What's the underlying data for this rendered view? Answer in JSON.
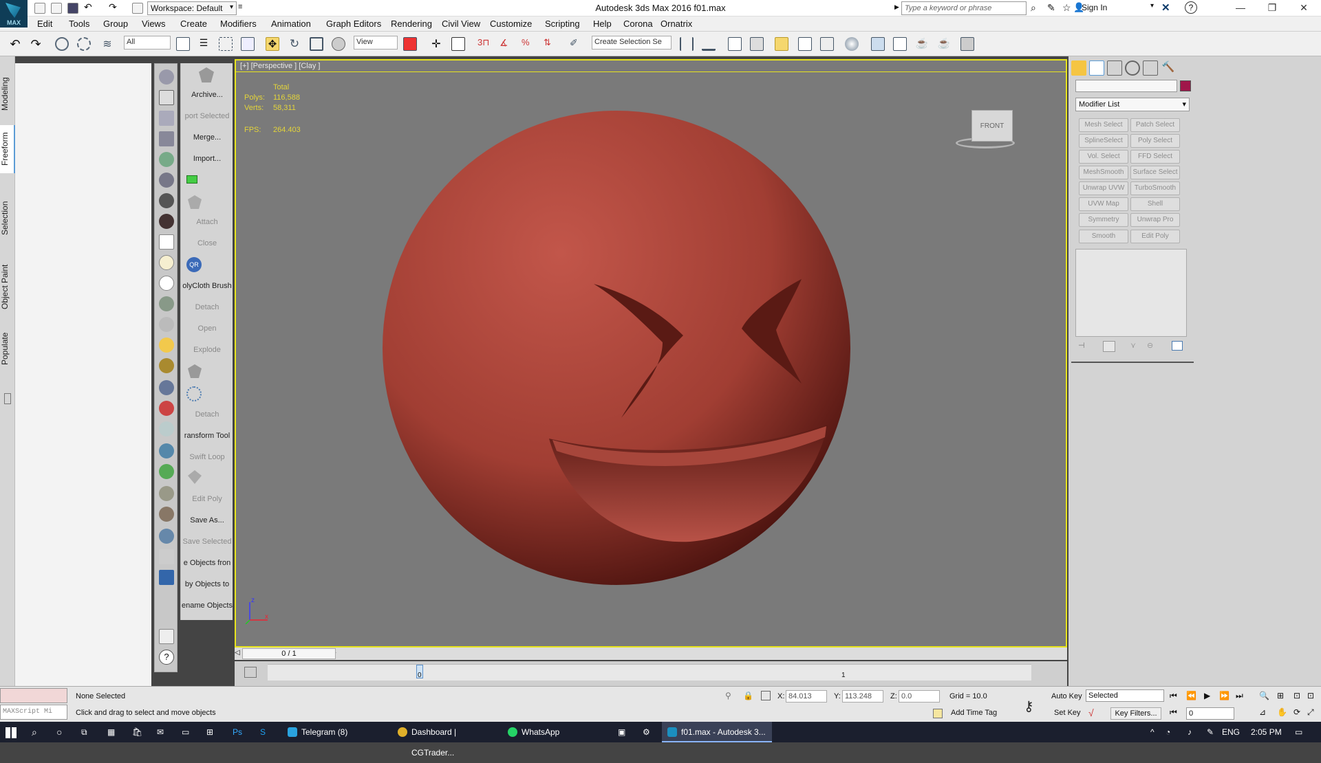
{
  "titlebar": {
    "workspace": "Workspace: Default",
    "title": "Autodesk 3ds Max 2016     f01.max",
    "search_placeholder": "Type a keyword or phrase",
    "sign_in": "Sign In",
    "logo": "MAX"
  },
  "menubar": [
    "Edit",
    "Tools",
    "Group",
    "Views",
    "Create",
    "Modifiers",
    "Animation",
    "Graph Editors",
    "Rendering",
    "Civil View",
    "Customize",
    "Scripting",
    "Help",
    "Corona",
    "Ornatrix"
  ],
  "toolbar": {
    "selection_filter": "All",
    "ref_coord": "View",
    "create_selection_set": "Create Selection Se"
  },
  "side_tabs": [
    "Modeling",
    "Freeform",
    "Selection",
    "Object Paint",
    "Populate"
  ],
  "label_column": [
    {
      "text": "Archive...",
      "enabled": true
    },
    {
      "text": "port Selected",
      "enabled": false
    },
    {
      "text": "Merge...",
      "enabled": true
    },
    {
      "text": "Import...",
      "enabled": true
    },
    {
      "text": "Attach",
      "enabled": false
    },
    {
      "text": "Close",
      "enabled": false
    },
    {
      "text": "olyCloth Brush",
      "enabled": true
    },
    {
      "text": "Detach",
      "enabled": false
    },
    {
      "text": "Open",
      "enabled": false
    },
    {
      "text": "Explode",
      "enabled": false
    },
    {
      "text": "Detach",
      "enabled": false
    },
    {
      "text": "ransform Tool",
      "enabled": true
    },
    {
      "text": "Swift Loop",
      "enabled": false
    },
    {
      "text": "Edit Poly",
      "enabled": false
    },
    {
      "text": "Save As...",
      "enabled": true
    },
    {
      "text": "Save Selected",
      "enabled": false
    },
    {
      "text": "e Objects fron",
      "enabled": true
    },
    {
      "text": "by Objects to",
      "enabled": true
    },
    {
      "text": "ename Objects",
      "enabled": true
    }
  ],
  "viewport": {
    "label": "[+] [Perspective ] [Clay ]",
    "stats": {
      "total_label": "Total",
      "polys_label": "Polys:",
      "polys": "116,588",
      "verts_label": "Verts:",
      "verts": "58,311",
      "fps_label": "FPS:",
      "fps": "264.403"
    },
    "viewcube_label": "FRONT",
    "axis_z": "z",
    "axis_x": "x",
    "model_color": "#b24a3e"
  },
  "timeline": {
    "frame_counter": "0 / 1",
    "tick_0": "0",
    "tick_1": "1"
  },
  "command_panel": {
    "modifier_list": "Modifier List",
    "color": "#a0164a",
    "buttons": [
      "Mesh Select",
      "Patch Select",
      "SplineSelect",
      "Poly Select",
      "Vol. Select",
      "FFD Select",
      "MeshSmooth",
      "Surface Select",
      "Unwrap UVW",
      "TurboSmooth",
      "UVW Map",
      "Shell",
      "Symmetry",
      "Unwrap Pro",
      "Smooth",
      "Edit Poly"
    ]
  },
  "status": {
    "maxscript": "MAXScript Mi",
    "selection": "None Selected",
    "prompt": "Click and drag to select and move objects",
    "x_label": "X:",
    "x_value": "84.013",
    "y_label": "Y:",
    "y_value": "113.248",
    "z_label": "Z:",
    "z_value": "0.0",
    "grid": "Grid = 10.0",
    "add_time_tag": "Add Time Tag",
    "auto_key": "Auto Key",
    "set_key": "Set Key",
    "selected": "Selected",
    "key_filters": "Key Filters...",
    "frame": "0"
  },
  "taskbar": {
    "apps": [
      "Telegram (8)",
      "Dashboard | CGTrader...",
      "WhatsApp",
      "f01.max - Autodesk 3..."
    ],
    "lang": "ENG",
    "time": "2:05 PM"
  }
}
